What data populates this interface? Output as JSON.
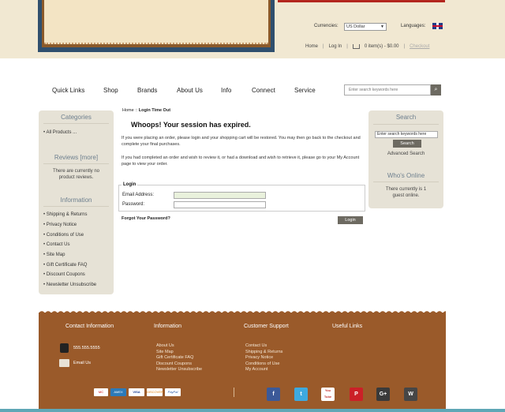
{
  "header": {
    "currencies_label": "Currencies:",
    "currency_selected": "US Dollar",
    "languages_label": "Languages:",
    "toplinks": {
      "home": "Home",
      "login": "Log In",
      "cart": "0 item(s) - $0.00",
      "checkout": "Checkout"
    }
  },
  "nav": {
    "items": [
      "Quick Links",
      "Shop",
      "Brands",
      "About Us",
      "Info",
      "Connect",
      "Service"
    ],
    "search_placeholder": "Enter search keywords here"
  },
  "left_sidebar": {
    "categories_title": "Categories",
    "all_products": "All Products ...",
    "reviews_title": "Reviews",
    "reviews_more": "[more]",
    "reviews_empty": "There are currently no product reviews.",
    "information_title": "Information",
    "info_links": [
      "Shipping & Returns",
      "Privacy Notice",
      "Conditions of Use",
      "Contact Us",
      "Site Map",
      "Gift Certificate FAQ",
      "Discount Coupons",
      "Newsletter Unsubscribe"
    ]
  },
  "right_sidebar": {
    "search_title": "Search",
    "search_input_value": "Enter search keywords here",
    "search_button": "Search",
    "advanced_search": "Advanced Search",
    "whos_online_title": "Who's Online",
    "whos_online_text": "There currently is 1 guest online."
  },
  "main": {
    "breadcrumb_home": "Home",
    "breadcrumb_sep": "::",
    "breadcrumb_current": "Login Time Out",
    "title": "Whoops! Your session has expired.",
    "para1": "If you were placing an order, please login and your shopping cart will be restored. You may then go back to the checkout and complete your final purchases.",
    "para2": "If you had completed an order and wish to review it, or had a download and wish to retrieve it, please go to your My Account page to view your order.",
    "login_legend": "Login",
    "email_label": "Email Address:",
    "password_label": "Password:",
    "forgot_link": "Forgot Your Password?",
    "login_button": "Login"
  },
  "footer": {
    "col_titles": [
      "Contact Information",
      "Information",
      "Customer Support",
      "Useful Links"
    ],
    "phone": "555.555.5555",
    "email": "Email Us",
    "info_links": [
      "About Us",
      "Site Map",
      "Gift Certificate FAQ",
      "Discount Coupons",
      "Newsletter Unsubscribe"
    ],
    "support_links": [
      "Contact Us",
      "Shipping & Returns",
      "Privacy Notice",
      "Conditions of Use",
      "My Account"
    ],
    "payment_icons": [
      "mastercard-icon",
      "amex-icon",
      "visa-icon",
      "discover-icon",
      "paypal-icon"
    ],
    "payment_labels": [
      "MC",
      "AMEX",
      "VISA",
      "DISCOVER",
      "PayPal"
    ],
    "social_icons": [
      "facebook-icon",
      "twitter-icon",
      "youtube-icon",
      "pinterest-icon",
      "googleplus-icon",
      "wordpress-icon"
    ],
    "social_labels": [
      "f",
      "t",
      "You Tube",
      "P",
      "G+",
      "W"
    ]
  },
  "colors": {
    "header_band": "#f1e8d2",
    "footer_brown": "#9a5a2a",
    "sidebar_bg": "#e6e2d6",
    "button_gray": "#6d6a61",
    "heading_blue": "#6d7f8e",
    "accent_red": "#b3261e"
  }
}
